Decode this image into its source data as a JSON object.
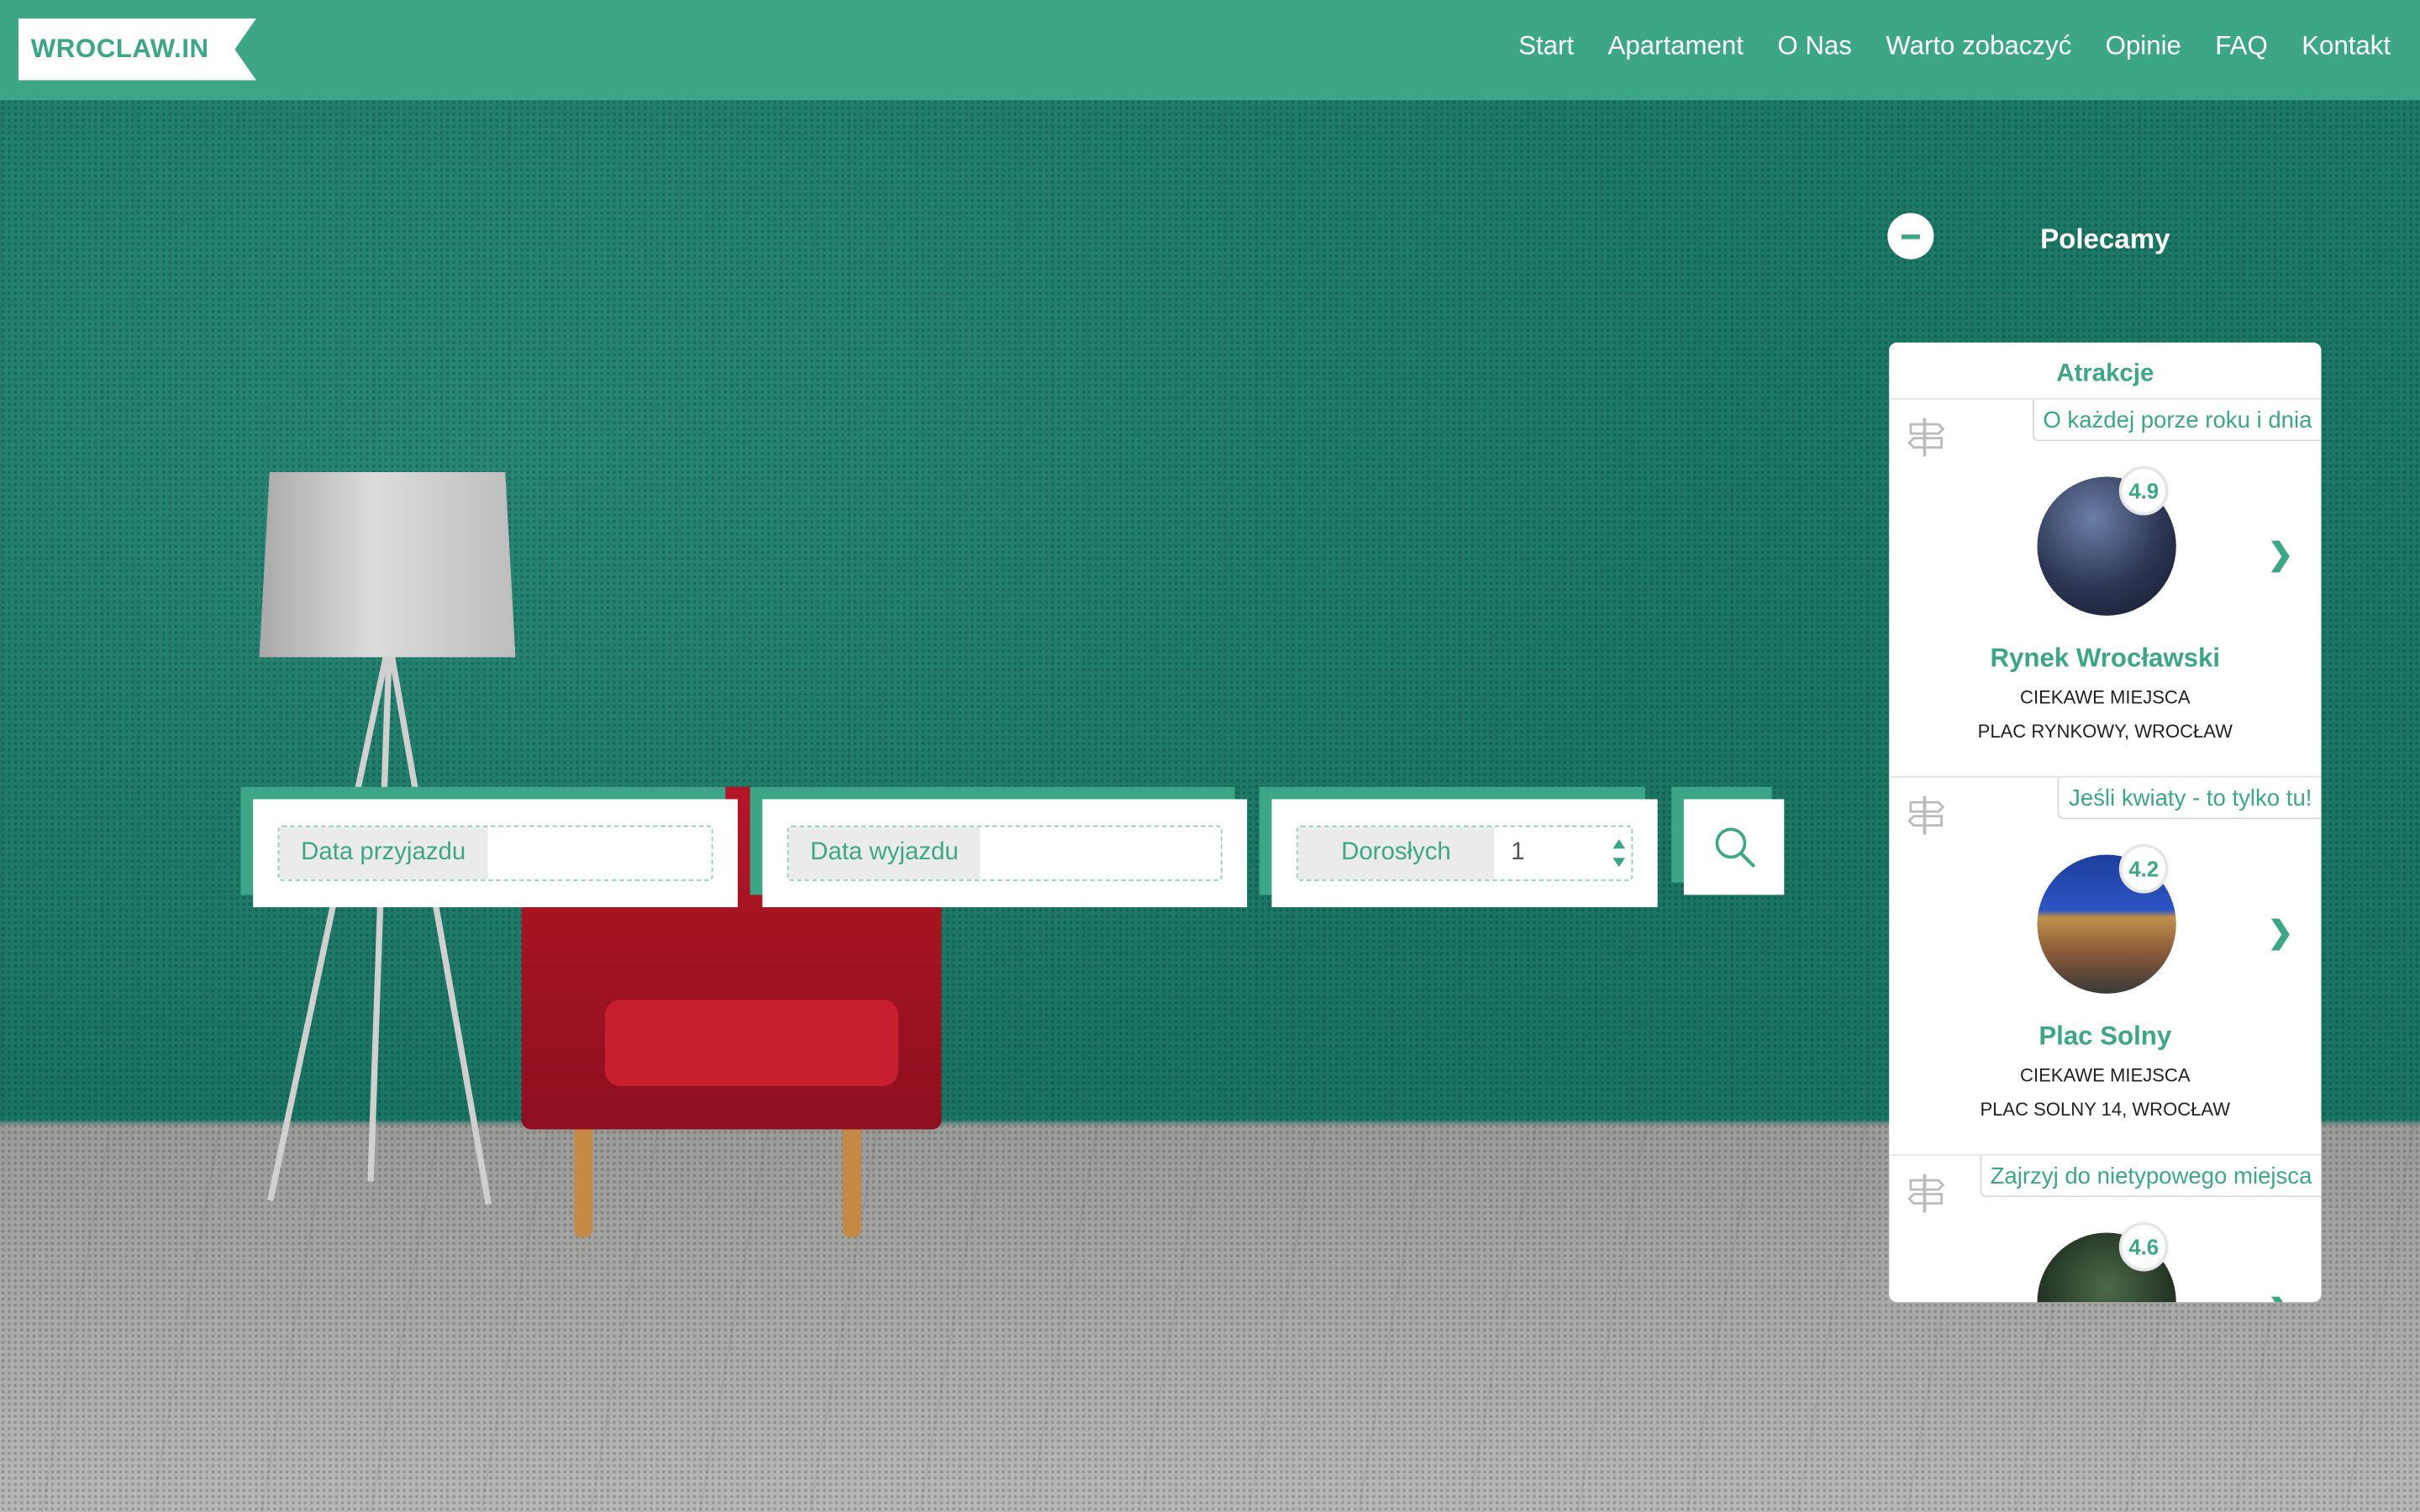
{
  "header": {
    "logo": "WROCLAW.IN",
    "nav": [
      "Start",
      "Apartament",
      "O Nas",
      "Warto zobaczyć",
      "Opinie",
      "FAQ",
      "Kontakt"
    ]
  },
  "search": {
    "arrival_label": "Data przyjazdu",
    "departure_label": "Data wyjazdu",
    "adults_label": "Dorosłych",
    "adults_value": "1"
  },
  "sidebar": {
    "title": "Polecamy",
    "panel_title": "Atrakcje",
    "cards": [
      {
        "tag": "O każdej porze roku i dnia",
        "rating": "4.9",
        "name": "Rynek Wrocławski",
        "category": "CIEKAWE MIEJSCA",
        "address": "PLAC RYNKOWY, WROCŁAW"
      },
      {
        "tag": "Jeśli kwiaty - to tylko tu!",
        "rating": "4.2",
        "name": "Plac Solny",
        "category": "CIEKAWE MIEJSCA",
        "address": "PLAC SOLNY 14, WROCŁAW"
      },
      {
        "tag": "Zajrzyj do nietypowego miejsca",
        "rating": "4.6",
        "name": "",
        "category": "",
        "address": ""
      }
    ]
  },
  "colors": {
    "accent": "#3da686",
    "wall": "#1a7463",
    "floor": "#b8b8b6"
  }
}
